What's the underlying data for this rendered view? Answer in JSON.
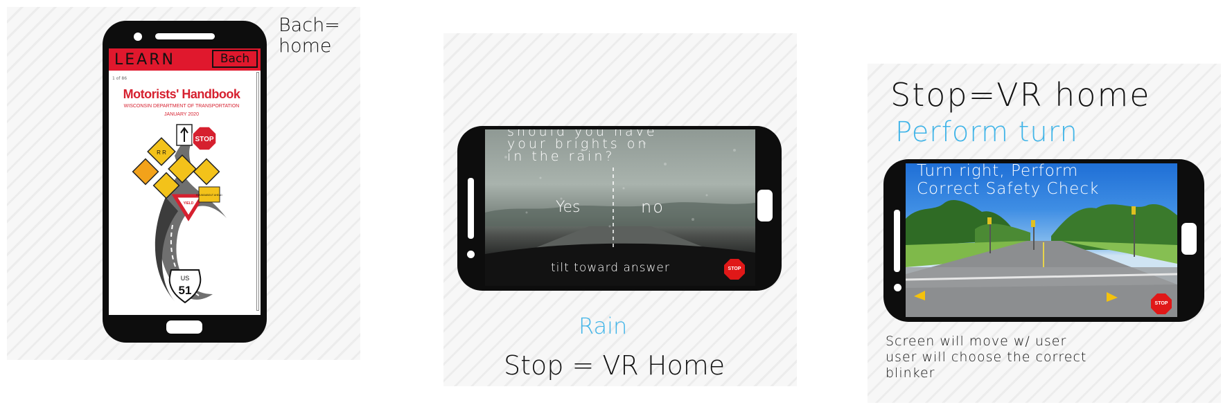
{
  "panel1": {
    "annotation_line1": "Bach=",
    "annotation_line2": "home",
    "screen": {
      "header_label": "LEARN",
      "back_button": "Bach",
      "page_indicator": "1 of 86",
      "doc_title": "Motorists' Handbook",
      "doc_subtitle": "WISCONSIN DEPARTMENT OF TRANSPORTATION",
      "doc_date": "JANUARY 2020",
      "sign_stop": "STOP",
      "sign_rr": "R R",
      "sign_yield": "YIELD",
      "sign_roundabout": "ROUNDABOUT AHEAD",
      "shield_top": "US",
      "shield_number": "51"
    }
  },
  "panel2": {
    "question_line1": "should you have",
    "question_line2": "your brights on",
    "question_line3": "in the rain?",
    "answer_yes": "Yes",
    "answer_no": "no",
    "instruction": "tilt toward answer",
    "stop_sign": "STOP",
    "caption_title": "Rain",
    "caption_note": "Stop = VR Home"
  },
  "panel3": {
    "header_note": "Stop=VR home",
    "title": "Perform turn",
    "screen_text_line1": "Turn right, Perform",
    "screen_text_line2": "Correct Safety Check",
    "stop_sign": "STOP",
    "footnote_line1": "Screen will move w/ user",
    "footnote_line2": "user will choose the correct",
    "footnote_line3": "blinker"
  },
  "colors": {
    "learn_bar": "#e0182d",
    "accent_blue": "#3fb4e8",
    "stop_red": "#e01818",
    "arrow_yellow": "#f4c20d"
  }
}
